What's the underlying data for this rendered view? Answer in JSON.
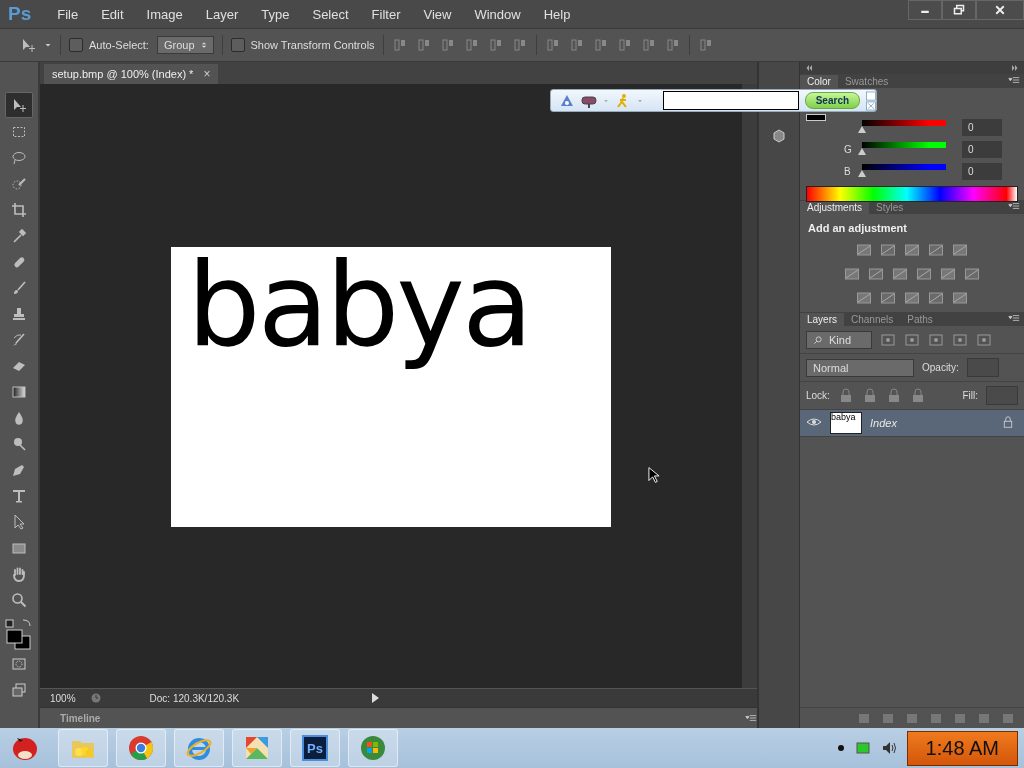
{
  "app_logo": "Ps",
  "menu": [
    "File",
    "Edit",
    "Image",
    "Layer",
    "Type",
    "Select",
    "Filter",
    "View",
    "Window",
    "Help"
  ],
  "options_bar": {
    "auto_select": {
      "label": "Auto-Select:",
      "checked": false
    },
    "auto_select_target": "Group",
    "transform_controls": {
      "label": "Show Transform Controls",
      "checked": false
    }
  },
  "document_tab": {
    "title": "setup.bmp @ 100% (Index) *",
    "close": "×"
  },
  "canvas_text": "babya",
  "tools": [
    {
      "kind": "move",
      "selected": true
    },
    {
      "kind": "marquee",
      "selected": false
    },
    {
      "kind": "lasso",
      "selected": false
    },
    {
      "kind": "quick-select",
      "selected": false
    },
    {
      "kind": "crop",
      "selected": false
    },
    {
      "kind": "eyedropper",
      "selected": false
    },
    {
      "kind": "healing",
      "selected": false
    },
    {
      "kind": "brush",
      "selected": false
    },
    {
      "kind": "stamp",
      "selected": false
    },
    {
      "kind": "history-brush",
      "selected": false
    },
    {
      "kind": "eraser",
      "selected": false
    },
    {
      "kind": "gradient",
      "selected": false
    },
    {
      "kind": "blur",
      "selected": false
    },
    {
      "kind": "dodge",
      "selected": false
    },
    {
      "kind": "pen",
      "selected": false
    },
    {
      "kind": "type",
      "selected": false
    },
    {
      "kind": "path-select",
      "selected": false
    },
    {
      "kind": "shape",
      "selected": false
    },
    {
      "kind": "hand",
      "selected": false
    },
    {
      "kind": "zoom",
      "selected": false
    }
  ],
  "status_bar": {
    "zoom": "100%",
    "doc_info": "Doc: 120.3K/120.3K"
  },
  "timeline": {
    "label": "Timeline"
  },
  "search_toolbar": {
    "button": "Search"
  },
  "color_panel": {
    "tabs": [
      {
        "label": "Color",
        "selected": true
      },
      {
        "label": "Swatches",
        "selected": false
      }
    ],
    "channels": [
      {
        "value": "0",
        "level": 0,
        "color": "#ff0000"
      },
      {
        "label": "G",
        "value": "0",
        "level": 0,
        "color": "#00ff00"
      },
      {
        "label": "B",
        "value": "0",
        "level": 0,
        "color": "#0000ff"
      }
    ]
  },
  "adjustments_panel": {
    "tabs": [
      {
        "label": "Adjustments",
        "selected": true
      },
      {
        "label": "Styles",
        "selected": false
      }
    ],
    "heading": "Add an adjustment"
  },
  "layers_panel": {
    "tabs": [
      {
        "label": "Layers",
        "selected": true
      },
      {
        "label": "Channels",
        "selected": false
      },
      {
        "label": "Paths",
        "selected": false
      }
    ],
    "filter": "Kind",
    "blend_mode": "Normal",
    "opacity_label": "Opacity:",
    "lock_label": "Lock:",
    "fill_label": "Fill:",
    "layers": [
      {
        "name": "Index",
        "thumbnail_text": "babya",
        "visible": true,
        "locked": true,
        "selected": true
      }
    ]
  },
  "taskbar": {
    "apps": [
      {
        "kind": "bird"
      },
      {
        "kind": "folder"
      },
      {
        "kind": "chrome"
      },
      {
        "kind": "ie"
      },
      {
        "kind": "tangram"
      },
      {
        "kind": "photoshop",
        "label": "Ps"
      },
      {
        "kind": "windows"
      }
    ],
    "clock": "1:48 AM"
  }
}
